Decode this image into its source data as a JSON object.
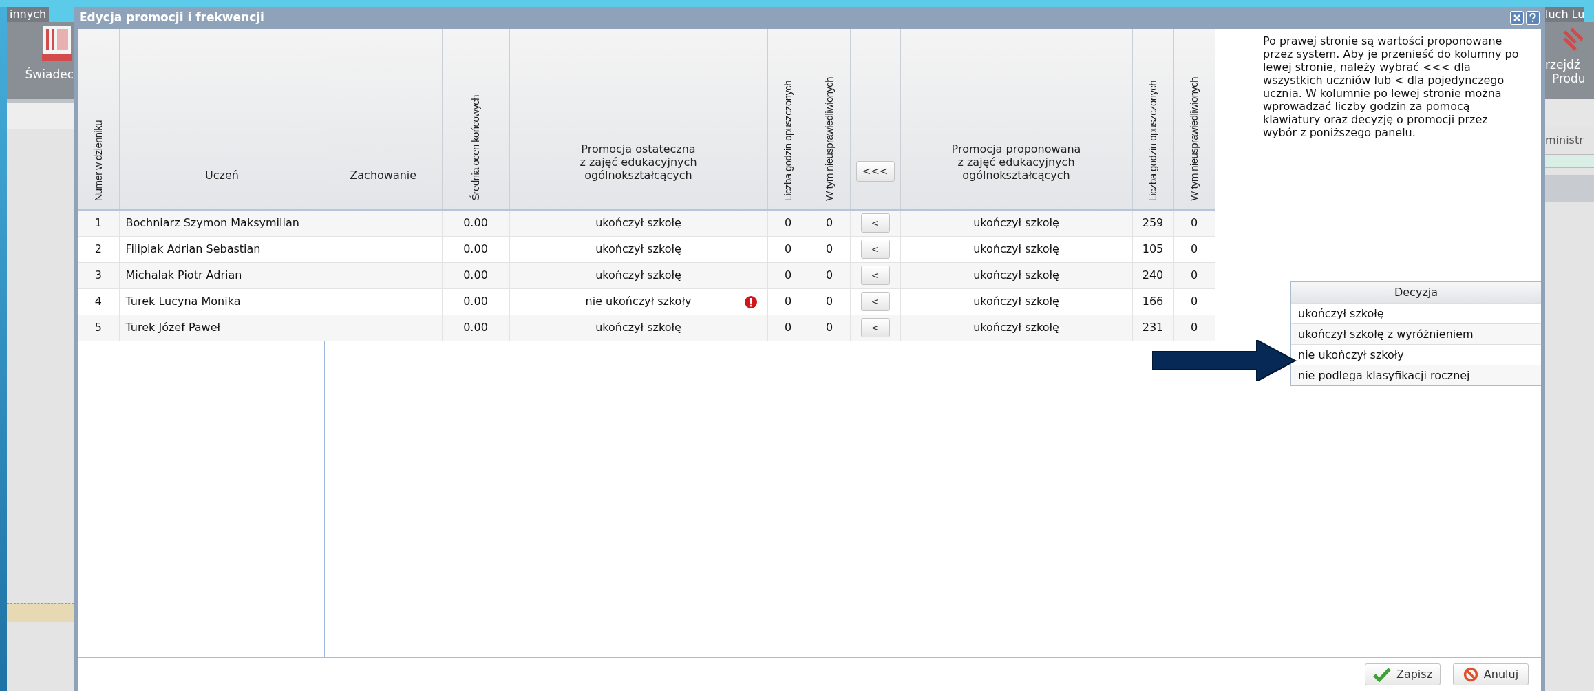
{
  "background": {
    "left_tab": "innych",
    "left_button": "Świadec",
    "right_tab": "luch Lu",
    "right_button": [
      "rzejdź",
      "Produ"
    ],
    "right_label": "ministr"
  },
  "dialog": {
    "title": "Edycja promocji i frekwencji",
    "columns": {
      "number": "Numer w dzienniku",
      "student": "Uczeń",
      "behavior": "Zachowanie",
      "average": "Średnia ocen końcowych",
      "final": [
        "Promocja ostateczna",
        "z zajęć edukacyjnych",
        "ogólnokształcących"
      ],
      "hours": "Liczba godzin opuszczonych",
      "unexcused": "W tym nieusprawiedliwionych",
      "proposed": [
        "Promocja proponowana",
        "z zajęć edukacyjnych",
        "ogólnokształcących"
      ],
      "proposed_hours": "Liczba godzin opuszczonych",
      "proposed_unexcused": "W tym nieusprawiedliwionych"
    },
    "copy_all_button": "<<<",
    "rows": [
      {
        "number": "1",
        "student": "Bochniarz Szymon Maksymilian",
        "average": "0.00",
        "final": "ukończył szkołę",
        "warning": false,
        "hours": "0",
        "unexcused": "0",
        "copy_button": "<",
        "proposed": "ukończył szkołę",
        "proposed_hours": "259",
        "proposed_unexcused": "0"
      },
      {
        "number": "2",
        "student": "Filipiak Adrian Sebastian",
        "average": "0.00",
        "final": "ukończył szkołę",
        "warning": false,
        "hours": "0",
        "unexcused": "0",
        "copy_button": "<",
        "proposed": "ukończył szkołę",
        "proposed_hours": "105",
        "proposed_unexcused": "0"
      },
      {
        "number": "3",
        "student": "Michalak Piotr Adrian",
        "average": "0.00",
        "final": "ukończył szkołę",
        "warning": false,
        "hours": "0",
        "unexcused": "0",
        "copy_button": "<",
        "proposed": "ukończył szkołę",
        "proposed_hours": "240",
        "proposed_unexcused": "0"
      },
      {
        "number": "4",
        "student": "Turek Lucyna Monika",
        "average": "0.00",
        "final": "nie ukończył szkoły",
        "warning": true,
        "hours": "0",
        "unexcused": "0",
        "copy_button": "<",
        "proposed": "ukończył szkołę",
        "proposed_hours": "166",
        "proposed_unexcused": "0"
      },
      {
        "number": "5",
        "student": "Turek Józef Paweł",
        "average": "0.00",
        "final": "ukończył szkołę",
        "warning": false,
        "hours": "0",
        "unexcused": "0",
        "copy_button": "<",
        "proposed": "ukończył szkołę",
        "proposed_hours": "231",
        "proposed_unexcused": "0"
      }
    ],
    "info_text": "Po prawej stronie są wartości proponowane przez system. Aby je przenieść do kolumny po lewej stronie, należy wybrać <<< dla wszystkich uczniów lub < dla pojedynczego ucznia. W kolumnie po lewej stronie można wprowadzać liczby godzin za pomocą klawiatury oraz decyzję o promocji przez wybór z poniższego panelu.",
    "decision": {
      "header": "Decyzja",
      "options": [
        {
          "label": "ukończył szkołę",
          "pointed": false
        },
        {
          "label": "ukończył szkołę z wyróżnieniem",
          "pointed": false
        },
        {
          "label": "nie ukończył szkoły",
          "pointed": true
        },
        {
          "label": "nie podlega klasyfikacji rocznej",
          "pointed": false
        }
      ]
    },
    "buttons": [
      {
        "kind": "save",
        "label": "Zapisz"
      },
      {
        "kind": "cancel",
        "label": "Anuluj"
      }
    ]
  }
}
